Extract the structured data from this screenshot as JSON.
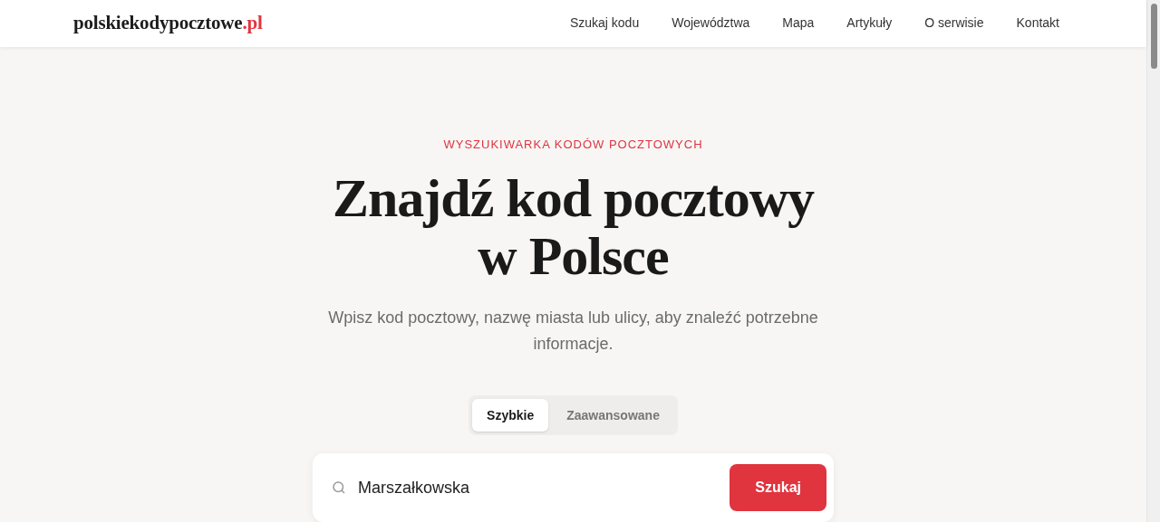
{
  "header": {
    "logo": {
      "name": "polskiekodypocztowe",
      "suffix": ".pl"
    },
    "nav": [
      {
        "label": "Szukaj kodu"
      },
      {
        "label": "Województwa"
      },
      {
        "label": "Mapa"
      },
      {
        "label": "Artykuły"
      },
      {
        "label": "O serwisie"
      },
      {
        "label": "Kontakt"
      }
    ]
  },
  "hero": {
    "eyebrow": "WYSZUKIWARKA KODÓW POCZTOWYCH",
    "title": "Znajdź kod pocztowy w Polsce",
    "subtitle": "Wpisz kod pocztowy, nazwę miasta lub ulicy, aby znaleźć potrzebne informacje."
  },
  "search_tabs": [
    {
      "label": "Szybkie",
      "selected": true
    },
    {
      "label": "Zaawansowane",
      "selected": false
    }
  ],
  "search": {
    "value": "Marszałkowska",
    "button": "Szukaj"
  }
}
